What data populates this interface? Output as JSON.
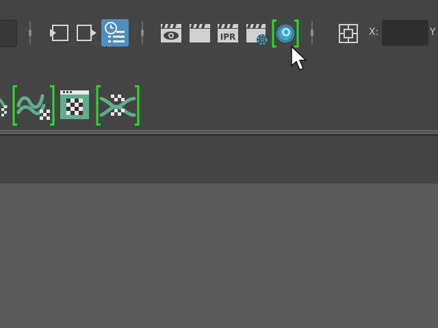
{
  "toolbar": {
    "coordinates": {
      "x_label": "X:",
      "y_label": "Y",
      "x_value": ""
    },
    "buttons": [
      {
        "id": "input-ports",
        "icon": "input-arrow-icon"
      },
      {
        "id": "output-ports",
        "icon": "output-arrow-icon"
      },
      {
        "id": "history",
        "icon": "history-list-icon",
        "active": true
      },
      {
        "id": "render-view",
        "icon": "clapper-eye-icon"
      },
      {
        "id": "render",
        "icon": "clapper-icon"
      },
      {
        "id": "ipr-render",
        "icon": "clapper-ipr-icon",
        "label": "IPR"
      },
      {
        "id": "render-settings",
        "icon": "clapper-gear-icon"
      },
      {
        "id": "hypershade",
        "icon": "hypershade-sphere-icon",
        "highlighted": true
      },
      {
        "id": "snapshot",
        "icon": "grid-square-icon"
      }
    ]
  },
  "shelf": {
    "items": [
      {
        "id": "shelf-partial",
        "icon": "checker-icon"
      },
      {
        "id": "shelf-wave-checker",
        "icon": "wave-checker-icon",
        "highlighted": true
      },
      {
        "id": "shelf-window-checker",
        "icon": "window-checker-icon"
      },
      {
        "id": "shelf-cross-checker",
        "icon": "cross-checker-icon",
        "highlighted": true
      }
    ]
  },
  "colors": {
    "toolbar_bg": "#444444",
    "viewport_bg": "#5b5b5b",
    "accent_blue": "#4f8fc0",
    "highlight_green": "#22e022",
    "shelf_green": "#5fae8a"
  }
}
